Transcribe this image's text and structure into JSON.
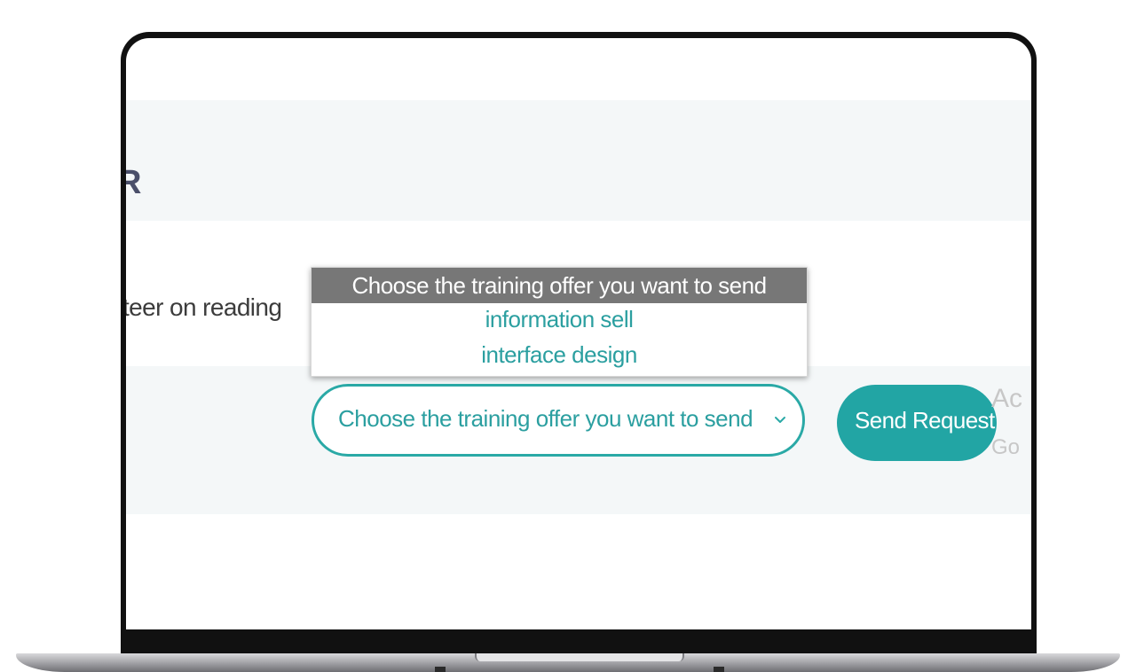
{
  "page": {
    "partial_heading_letter": "R",
    "row_text": "teer on reading"
  },
  "training_select": {
    "value": "Choose the training offer you want to send",
    "options": [
      "Choose the training offer you want to send",
      "information sell",
      "interface design"
    ],
    "selected_index": 0
  },
  "send_button": {
    "label": "Send Request"
  },
  "activation_watermark": {
    "line1": "Ac",
    "line2": "Go"
  },
  "colors": {
    "accent": "#22a5a4",
    "accent_text": "#2b9fa0",
    "band_background": "#f4f7f8",
    "option_highlight": "#777777"
  },
  "icons": {
    "select_arrow": "chevron-down-icon"
  }
}
